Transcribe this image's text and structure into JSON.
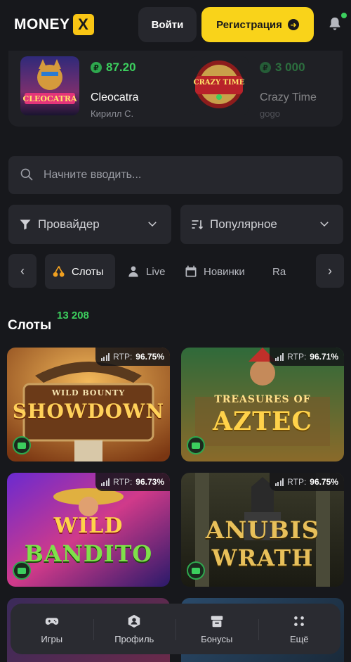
{
  "header": {
    "logo_text": "MONEY",
    "logo_mark": "X",
    "login_label": "Войти",
    "register_label": "Регистрация",
    "bell_icon": "bell-icon"
  },
  "winners": [
    {
      "amount": "87.20",
      "game": "Cleocatra",
      "user": "Кирилл С.",
      "thumb_label": "CLEOCATRA"
    },
    {
      "amount": "3 000",
      "game": "Crazy Time",
      "user": "gogo",
      "thumb_label": "CRAZY TIME"
    }
  ],
  "currency_symbol": "₽",
  "search": {
    "placeholder": "Начните вводить..."
  },
  "filters": {
    "provider_label": "Провайдер",
    "sort_label": "Популярное"
  },
  "tabs": [
    {
      "label": "Слоты",
      "icon": "cherries-icon",
      "active": true
    },
    {
      "label": "Live",
      "icon": "dealer-icon",
      "active": false
    },
    {
      "label": "Новинки",
      "icon": "calendar-icon",
      "active": false
    },
    {
      "label": "Rake",
      "icon": "chest-icon",
      "active": false
    }
  ],
  "section": {
    "title": "Слоты",
    "count": "13 208"
  },
  "games": [
    {
      "line1": "WILD BOUNTY",
      "line2": "SHOWDOWN",
      "rtp_label": "RTP:",
      "rtp": "96.75%"
    },
    {
      "line1": "TREASURES OF",
      "line2": "AZTEC",
      "rtp_label": "RTP:",
      "rtp": "96.71%"
    },
    {
      "line1": "WILD",
      "line2": "BANDITO",
      "rtp_label": "RTP:",
      "rtp": "96.73%"
    },
    {
      "line1": "ANUBIS",
      "line2": "WRATH",
      "rtp_label": "RTP:",
      "rtp": "96.75%"
    }
  ],
  "bottom_nav": [
    {
      "label": "Игры",
      "icon": "gamepad-icon"
    },
    {
      "label": "Профиль",
      "icon": "profile-icon"
    },
    {
      "label": "Бонусы",
      "icon": "gift-icon"
    },
    {
      "label": "Ещё",
      "icon": "dots-grid-icon"
    }
  ],
  "colors": {
    "accent": "#f9d31a",
    "win_green": "#3ccf5e",
    "bg": "#17181c",
    "surface": "#26272d"
  }
}
